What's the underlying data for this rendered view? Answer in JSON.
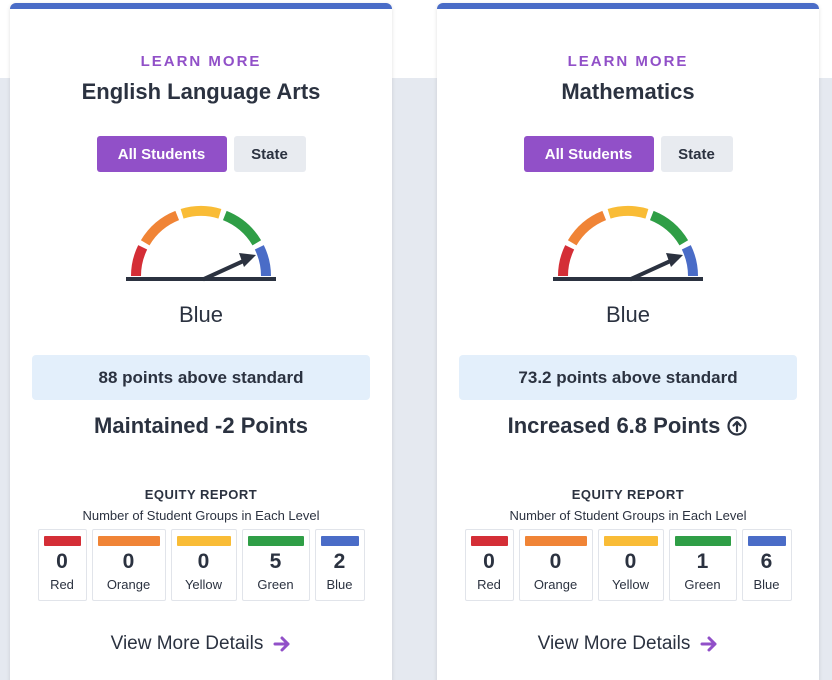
{
  "colors": {
    "purple": "#9150c8",
    "card_top": "#4a6cc7",
    "red": "#d42e36",
    "orange": "#f08436",
    "yellow": "#f9bc36",
    "green": "#2f9e46",
    "blue": "#4a6cc7",
    "points_bg": "#e3effb"
  },
  "cards": [
    {
      "learn_more": "LEARN MORE",
      "subject": "English Language Arts",
      "toggle": {
        "all_students": "All Students",
        "state": "State"
      },
      "gauge_icon": "speedometer-gauge-icon",
      "performance_level": "Blue",
      "points": "88 points above standard",
      "change": "Maintained -2 Points",
      "change_icon": "",
      "equity": {
        "title": "EQUITY REPORT",
        "subtitle": "Number of Student Groups in Each Level",
        "levels": [
          {
            "name": "Red",
            "count": "0"
          },
          {
            "name": "Orange",
            "count": "0"
          },
          {
            "name": "Yellow",
            "count": "0"
          },
          {
            "name": "Green",
            "count": "5"
          },
          {
            "name": "Blue",
            "count": "2"
          }
        ]
      },
      "details_link": "View More Details"
    },
    {
      "learn_more": "LEARN MORE",
      "subject": "Mathematics",
      "toggle": {
        "all_students": "All Students",
        "state": "State"
      },
      "gauge_icon": "speedometer-gauge-icon",
      "performance_level": "Blue",
      "points": "73.2 points above standard",
      "change": "Increased 6.8 Points",
      "change_icon": "arrow-up-circle-icon",
      "equity": {
        "title": "EQUITY REPORT",
        "subtitle": "Number of Student Groups in Each Level",
        "levels": [
          {
            "name": "Red",
            "count": "0"
          },
          {
            "name": "Orange",
            "count": "0"
          },
          {
            "name": "Yellow",
            "count": "0"
          },
          {
            "name": "Green",
            "count": "1"
          },
          {
            "name": "Blue",
            "count": "6"
          }
        ]
      },
      "details_link": "View More Details"
    }
  ]
}
